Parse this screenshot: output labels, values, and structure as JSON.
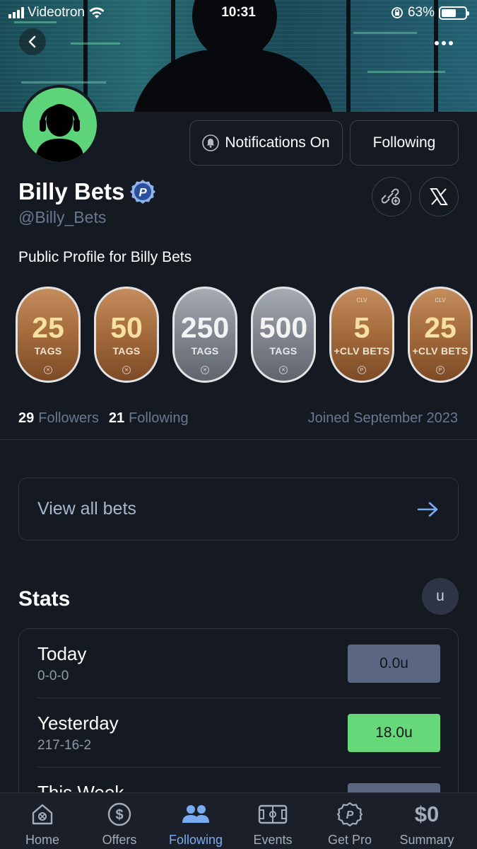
{
  "status_bar": {
    "carrier": "Videotron",
    "time": "10:31",
    "battery": "63%",
    "battery_level": 0.63
  },
  "profile": {
    "name": "Billy Bets",
    "handle": "@Billy_Bets",
    "bio": "Public Profile for Billy Bets",
    "verified_badge": "P",
    "notifications_label": "Notifications On",
    "following_button_label": "Following"
  },
  "badges": [
    {
      "number": "25",
      "sub": "TAGS",
      "tier": "bronze",
      "top": ""
    },
    {
      "number": "50",
      "sub": "TAGS",
      "tier": "bronze",
      "top": ""
    },
    {
      "number": "250",
      "sub": "TAGS",
      "tier": "silver",
      "top": ""
    },
    {
      "number": "500",
      "sub": "TAGS",
      "tier": "silver",
      "top": ""
    },
    {
      "number": "5",
      "sub": "+CLV BETS",
      "tier": "bronze",
      "top": "CLV"
    },
    {
      "number": "25",
      "sub": "+CLV BETS",
      "tier": "bronze",
      "top": "CLV"
    }
  ],
  "social": {
    "followers_count": "29",
    "followers_label": "Followers",
    "following_count": "21",
    "following_label": "Following",
    "joined": "Joined September 2023"
  },
  "view_all_bets": "View all bets",
  "stats": {
    "title": "Stats",
    "unit_toggle": "u",
    "rows": [
      {
        "period": "Today",
        "record": "0-0-0",
        "value": "0.0u",
        "color": "#5b6782"
      },
      {
        "period": "Yesterday",
        "record": "217-16-2",
        "value": "18.0u",
        "color": "#66d879"
      },
      {
        "period": "This Week",
        "record": "",
        "value": "",
        "color": "#5b6782"
      }
    ]
  },
  "nav": {
    "items": [
      {
        "label": "Home",
        "icon": "home-icon"
      },
      {
        "label": "Offers",
        "icon": "dollar-icon"
      },
      {
        "label": "Following",
        "icon": "people-icon"
      },
      {
        "label": "Events",
        "icon": "field-icon"
      },
      {
        "label": "Get Pro",
        "icon": "pro-badge-icon"
      },
      {
        "label": "Summary",
        "icon": "summary-amount"
      }
    ],
    "summary_amount": "$0",
    "active": "Following"
  },
  "colors": {
    "background": "#151922",
    "accent_blue": "#7aaaf0",
    "positive_green": "#66d879",
    "avatar_green": "#5ed47a",
    "neutral_pill": "#5b6782"
  }
}
